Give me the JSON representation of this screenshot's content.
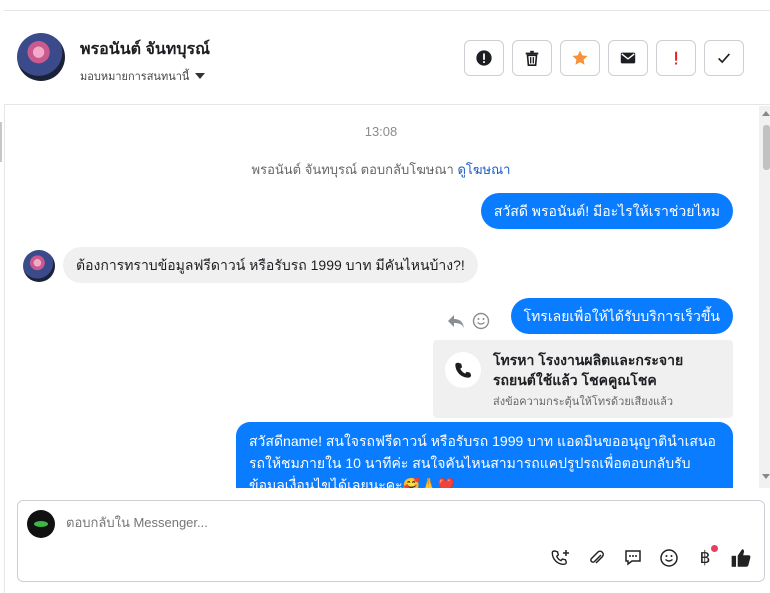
{
  "header": {
    "contact_name": "พรอนันต์ จันทบุรณ์",
    "assign_label": "มอบหมายการสนทนานี้",
    "actions": [
      {
        "name": "spam-button",
        "icon": "alert-circle-icon"
      },
      {
        "name": "delete-button",
        "icon": "trash-icon"
      },
      {
        "name": "star-button",
        "icon": "star-icon",
        "color": "#f7923a"
      },
      {
        "name": "mark-unread-button",
        "icon": "envelope-icon"
      },
      {
        "name": "follow-up-button",
        "icon": "exclamation-icon",
        "color": "#e02020"
      },
      {
        "name": "mark-done-button",
        "icon": "check-icon"
      }
    ]
  },
  "conversation": {
    "timestamp": "13:08",
    "reply_note_prefix": "พรอนันต์ จันทบุรณ์ ตอบกลับโฆษณา",
    "reply_note_link": "ดูโฆษณา",
    "messages": [
      {
        "direction": "outgoing",
        "text": "สวัสดี พรอนันต์! มีอะไรให้เราช่วยไหม"
      },
      {
        "direction": "incoming",
        "text": "ต้องการทราบข้อมูลฟรีดาวน์ หรือรับรถ 1999 บาท มีคันไหนบ้าง?!"
      },
      {
        "direction": "outgoing",
        "text": "โทรเลยเพื่อให้ได้รับบริการเร็วขึ้น"
      },
      {
        "direction": "outgoing",
        "text": "สวัสดีname! สนใจรถฟรีดาวน์ หรือรับรถ 1999 บาท แอดมินขออนุญาตินำเสนอรถให้ชมภายใน 10 นาทีค่ะ สนใจคันไหนสามารถแคปรูปรถเพื่อตอบกลับรับข้อมูลเงื่อนไขได้เลยนะคะ🥰🙏❤️"
      }
    ],
    "call_card": {
      "title": "โทรหา โรงงานผลิตและกระจายรถยนต์ใช้แล้ว โชคคูณโชค",
      "subtitle": "ส่งข้อความกระตุ้นให้โทรด้วยเสียงแล้ว"
    }
  },
  "composer": {
    "placeholder": "ตอบกลับใน Messenger...",
    "tools": [
      "add-call-icon",
      "paperclip-icon",
      "saved-reply-icon",
      "emoji-icon",
      "baht-payment-icon",
      "like-icon"
    ],
    "accent": "#0a7cff"
  }
}
